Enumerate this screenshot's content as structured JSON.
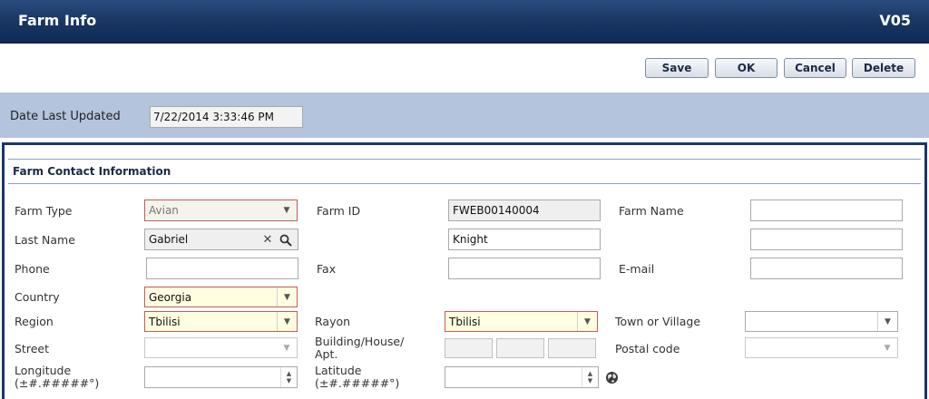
{
  "header": {
    "title": "Farm Info",
    "version": "V05"
  },
  "toolbar": {
    "save": "Save",
    "ok": "OK",
    "cancel": "Cancel",
    "delete": "Delete"
  },
  "meta": {
    "date_label": "Date Last Updated",
    "date_value": "7/22/2014 3:33:46 PM"
  },
  "section": {
    "title": "Farm Contact Information"
  },
  "fields": {
    "farm_type": {
      "label": "Farm Type",
      "value": "Avian"
    },
    "farm_id": {
      "label": "Farm ID",
      "value": "FWEB00140004"
    },
    "farm_name": {
      "label": "Farm Name",
      "value": ""
    },
    "last_name": {
      "label": "Last Name",
      "value": "Gabriel"
    },
    "first_name": {
      "value": "Knight"
    },
    "middle_name": {
      "value": ""
    },
    "phone": {
      "label": "Phone",
      "value": ""
    },
    "fax": {
      "label": "Fax",
      "value": ""
    },
    "email": {
      "label": "E-mail",
      "value": ""
    },
    "country": {
      "label": "Country",
      "value": "Georgia"
    },
    "region": {
      "label": "Region",
      "value": "Tbilisi"
    },
    "rayon": {
      "label": "Rayon",
      "value": "Tbilisi"
    },
    "town": {
      "label": "Town or Village",
      "value": ""
    },
    "street": {
      "label": "Street",
      "value": ""
    },
    "building": {
      "label": "Building/House/ Apt."
    },
    "postal": {
      "label": "Postal code",
      "value": ""
    },
    "longitude": {
      "label": "Longitude (±#.#####°)",
      "value": ""
    },
    "latitude": {
      "label": "Latitude (±#.#####°)",
      "value": ""
    }
  },
  "colors": {
    "header_bg": "#1a3866",
    "band_bg": "#b3c4dc",
    "required_border": "#c65b5b",
    "required_fill": "#fffee0"
  }
}
